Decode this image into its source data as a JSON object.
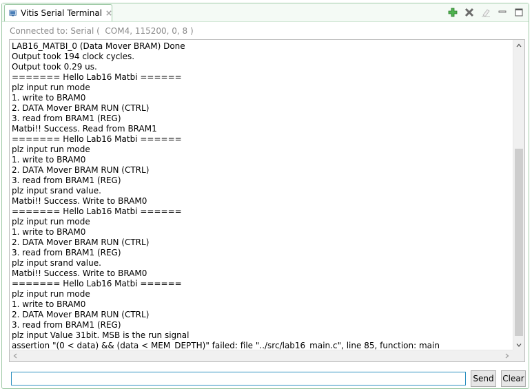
{
  "tab": {
    "title": "Vitis Serial Terminal",
    "icon": "terminal-icon"
  },
  "toolbar": {
    "icons": [
      "add-icon",
      "remove-icon",
      "clear-console-icon",
      "minimize-icon",
      "maximize-icon"
    ]
  },
  "connection": {
    "status_text": "Connected to: Serial (  COM4, 115200, 0, 8 )"
  },
  "console": {
    "lines": [
      "LAB16_MATBI_0 (Data Mover BRAM) Done",
      "Output took 194 clock cycles.",
      "Output took 0.29 us.",
      "======= Hello Lab16 Matbi ======",
      "plz input run mode",
      "1. write to BRAM0",
      "2. DATA Mover BRAM RUN (CTRL)",
      "3. read from BRAM1 (REG)",
      "Matbi!! Success. Read from BRAM1",
      "======= Hello Lab16 Matbi ======",
      "plz input run mode",
      "1. write to BRAM0",
      "2. DATA Mover BRAM RUN (CTRL)",
      "3. read from BRAM1 (REG)",
      "plz input srand value.",
      "Matbi!! Success. Write to BRAM0",
      "======= Hello Lab16 Matbi ======",
      "plz input run mode",
      "1. write to BRAM0",
      "2. DATA Mover BRAM RUN (CTRL)",
      "3. read from BRAM1 (REG)",
      "plz input srand value.",
      "Matbi!! Success. Write to BRAM0",
      "======= Hello Lab16 Matbi ======",
      "plz input run mode",
      "1. write to BRAM0",
      "2. DATA Mover BRAM RUN (CTRL)",
      "3. read from BRAM1 (REG)",
      "plz input Value 31bit. MSB is the run signal",
      "assertion \"(0 < data) && (data < MEM_DEPTH)\" failed: file \"../src/lab16_main.c\", line 85, function: main"
    ]
  },
  "input": {
    "value": "",
    "send_label": "Send",
    "clear_label": "Clear"
  },
  "colors": {
    "frame_border": "#9dc9a5",
    "add_green": "#3aa53a",
    "focus_border": "#2a8fbf",
    "status_gray": "#8a8a8a"
  }
}
